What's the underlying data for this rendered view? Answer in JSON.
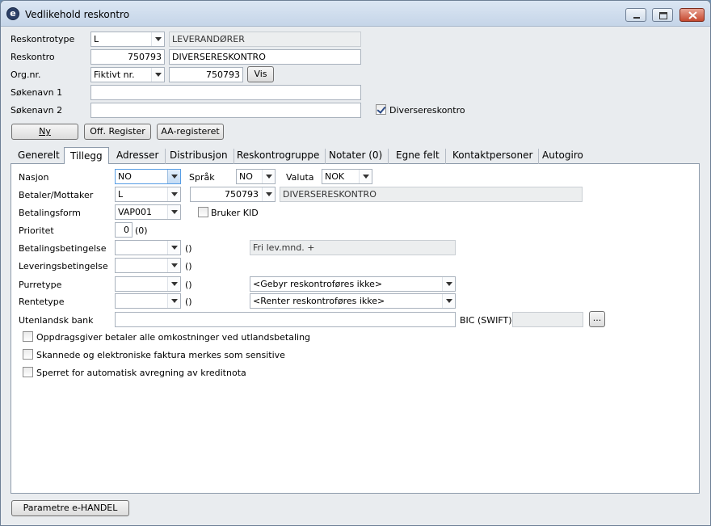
{
  "window": {
    "title": "Vedlikehold reskontro",
    "app_icon": "e-logo-icon",
    "controls": [
      "minimize-icon",
      "maximize-icon",
      "close-icon"
    ]
  },
  "header": {
    "reskontrotype": {
      "label": "Reskontrotype",
      "value": "L",
      "name": "LEVERANDØRER"
    },
    "reskontro": {
      "label": "Reskontro",
      "value": "750793",
      "name": "DIVERSERESKONTRO"
    },
    "orgnr": {
      "label": "Org.nr.",
      "type_value": "Fiktivt nr.",
      "value": "750793",
      "vis_label": "Vis"
    },
    "sokenavn1": {
      "label": "Søkenavn 1",
      "value": ""
    },
    "sokenavn2": {
      "label": "Søkenavn 2",
      "value": ""
    },
    "diverse": {
      "label": "Diversereskontro",
      "checked": true
    },
    "buttons": {
      "ny": "Ny",
      "off_register": "Off. Register",
      "aa_register": "AA-registeret"
    }
  },
  "tabs": [
    "Generelt",
    "Tillegg",
    "Adresser",
    "Distribusjon",
    "Reskontrogruppe",
    "Notater (0)",
    "Egne felt",
    "Kontaktpersoner",
    "Autogiro"
  ],
  "active_tab": "Tillegg",
  "form": {
    "nasjon": {
      "label": "Nasjon",
      "value": "NO"
    },
    "sprak": {
      "label": "Språk",
      "value": "NO"
    },
    "valuta": {
      "label": "Valuta",
      "value": "NOK"
    },
    "betaler": {
      "label": "Betaler/Mottaker",
      "type": "L",
      "number": "750793",
      "name": "DIVERSERESKONTRO"
    },
    "betalingsform": {
      "label": "Betalingsform",
      "value": "VAP001"
    },
    "bruker_kid": {
      "label": "Bruker KID",
      "checked": false
    },
    "prioritet": {
      "label": "Prioritet",
      "value": "0",
      "extra": "(0)"
    },
    "betalingsbetingelse": {
      "label": "Betalingsbetingelse",
      "value": "",
      "extra": "()",
      "desc": "Fri lev.mnd. +"
    },
    "leveringsbetingelse": {
      "label": "Leveringsbetingelse",
      "value": "",
      "extra": "()"
    },
    "purretype": {
      "label": "Purretype",
      "value": "",
      "extra": "()",
      "desc": "<Gebyr reskontroføres ikke>"
    },
    "rentetype": {
      "label": "Rentetype",
      "value": "",
      "extra": "()",
      "desc": "<Renter reskontroføres ikke>"
    },
    "utenlandsk_bank": {
      "label": "Utenlandsk bank",
      "value": ""
    },
    "bic": {
      "label": "BIC (SWIFT)",
      "value": "",
      "browse": "..."
    },
    "checkboxes": [
      {
        "label": "Oppdragsgiver betaler alle omkostninger ved utlandsbetaling",
        "checked": false
      },
      {
        "label": "Skannede og elektroniske faktura merkes som sensitive",
        "checked": false
      },
      {
        "label": "Sperret for automatisk avregning av kreditnota",
        "checked": false
      }
    ]
  },
  "footer": {
    "parametre_button": "Parametre e-HANDEL"
  }
}
